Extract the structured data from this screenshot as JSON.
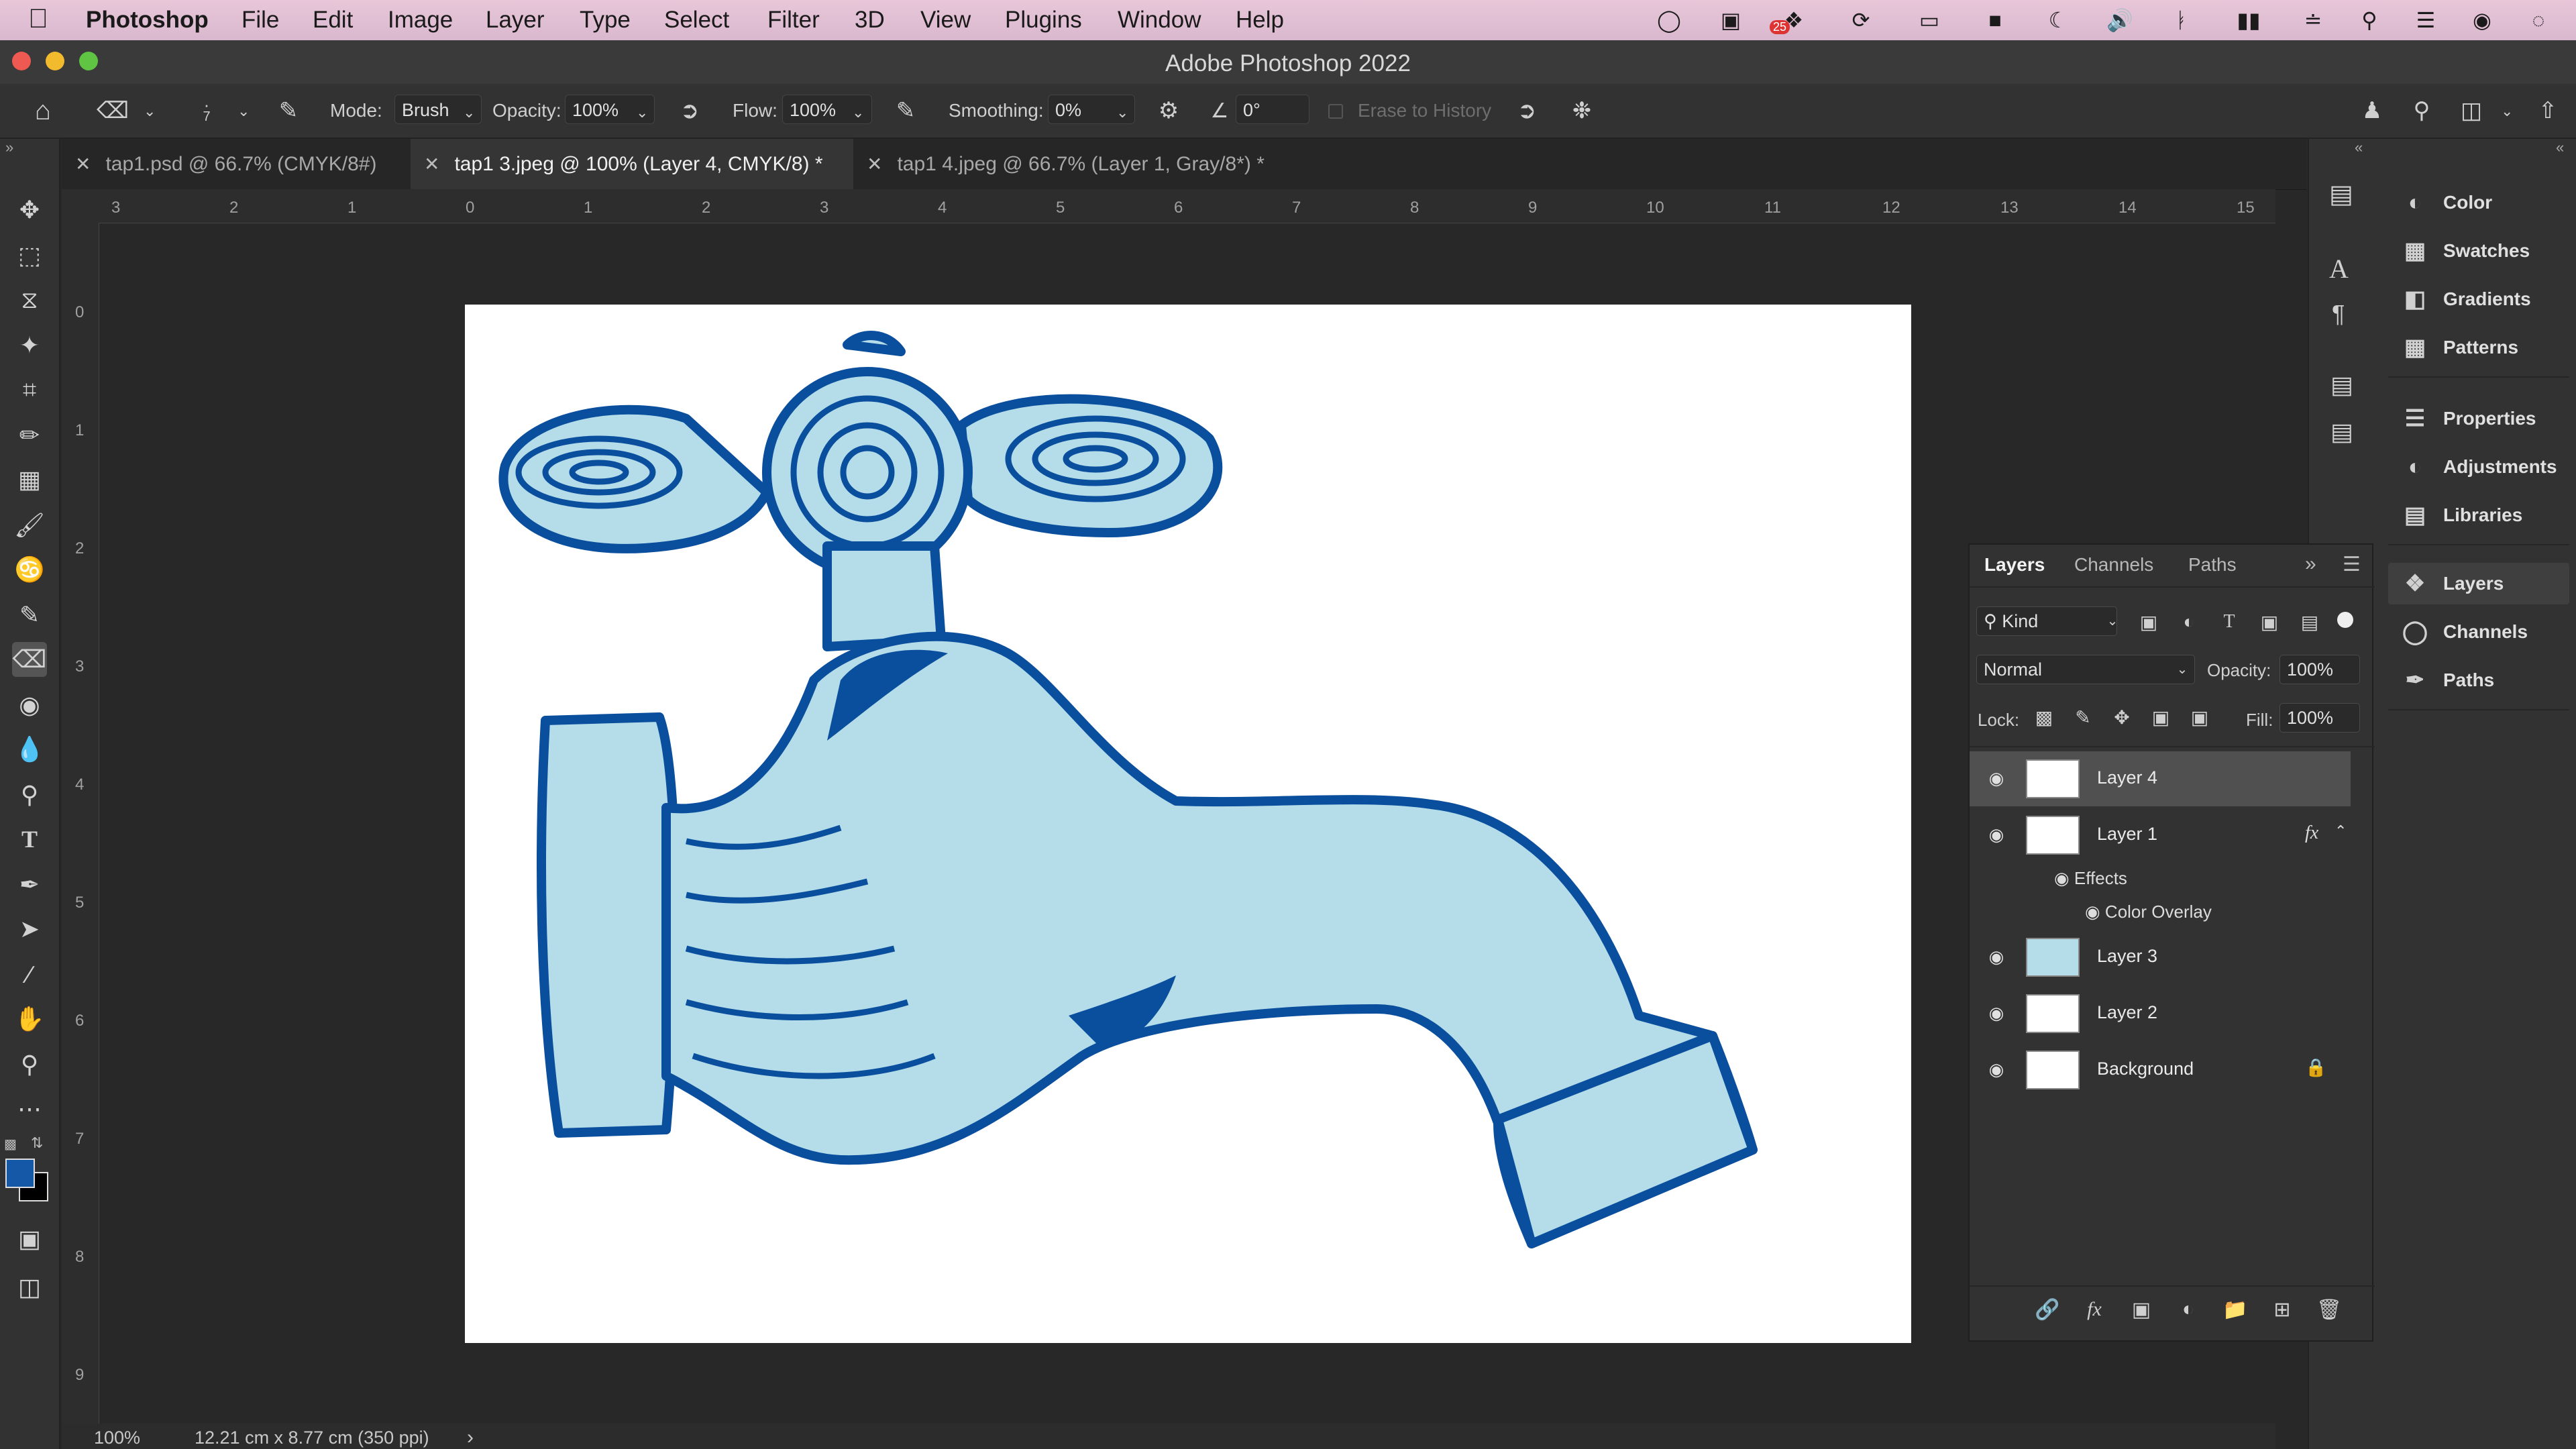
{
  "menubar": {
    "apple": "",
    "items": [
      "Photoshop",
      "File",
      "Edit",
      "Image",
      "Layer",
      "Type",
      "Select",
      "Filter",
      "3D",
      "View",
      "Plugins",
      "Window",
      "Help"
    ],
    "badge": "25"
  },
  "window": {
    "title": "Adobe Photoshop 2022"
  },
  "options": {
    "mode_label": "Mode:",
    "mode_value": "Brush",
    "opacity_label": "Opacity:",
    "opacity_value": "100%",
    "flow_label": "Flow:",
    "flow_value": "100%",
    "smoothing_label": "Smoothing:",
    "smoothing_value": "0%",
    "angle_value": "0°",
    "erase_history": "Erase to History",
    "brush_size": "7"
  },
  "tabs": [
    {
      "label": "tap1.psd @ 66.7% (CMYK/8#)"
    },
    {
      "label": "tap1 3.jpeg @ 100% (Layer 4, CMYK/8) *"
    },
    {
      "label": "tap1 4.jpeg @ 66.7% (Layer 1, Gray/8*) *"
    }
  ],
  "ruler_h": [
    "3",
    "2",
    "1",
    "0",
    "1",
    "2",
    "3",
    "4",
    "5",
    "6",
    "7",
    "8",
    "9",
    "10",
    "11",
    "12",
    "13",
    "14",
    "15"
  ],
  "ruler_v": [
    "0",
    "1",
    "2",
    "3",
    "4",
    "5",
    "6",
    "7",
    "8",
    "9"
  ],
  "status": {
    "zoom": "100%",
    "doc_size": "12.21 cm x 8.77 cm (350 ppi)",
    "arrow": "›"
  },
  "right_panel": {
    "group1": [
      "Color",
      "Swatches",
      "Gradients",
      "Patterns"
    ],
    "group2": [
      "Properties",
      "Adjustments",
      "Libraries"
    ],
    "group3": [
      "Layers",
      "Channels",
      "Paths"
    ]
  },
  "layers_panel": {
    "tabs": [
      "Layers",
      "Channels",
      "Paths"
    ],
    "kind": "Kind",
    "blend_mode": "Normal",
    "opacity_label": "Opacity:",
    "opacity_value": "100%",
    "lock_label": "Lock:",
    "fill_label": "Fill:",
    "fill_value": "100%",
    "layers": [
      "Layer 4",
      "Layer 1",
      "Layer 3",
      "Layer 2",
      "Background"
    ],
    "effects_label": "Effects",
    "effect_name": "Color Overlay",
    "fx": "fx"
  },
  "colors": {
    "accent_blue": "#0a4e9e",
    "fill_light_blue": "#b5dde9",
    "foreground": "#1658a8",
    "background": "#000000"
  }
}
